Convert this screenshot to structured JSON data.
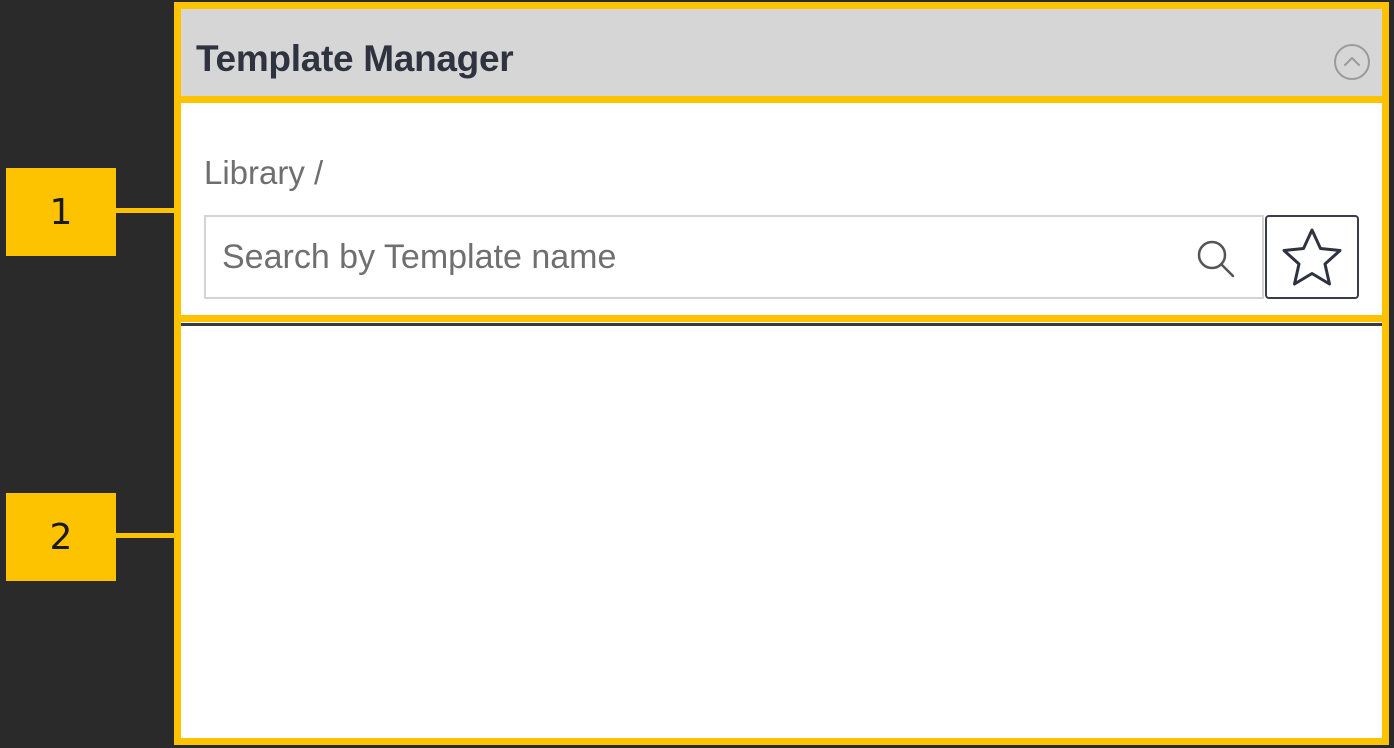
{
  "callouts": {
    "one": "1",
    "two": "2"
  },
  "panel": {
    "title": "Template Manager",
    "collapse_icon": "chevron-up-circle-icon"
  },
  "breadcrumb": {
    "text": "Library /"
  },
  "search": {
    "value": "",
    "placeholder": "Search by Template name",
    "icon": "search-icon"
  },
  "favorites": {
    "icon": "star-icon"
  },
  "colors": {
    "accent": "#fdc300",
    "background": "#2a2a2a",
    "header_bg": "#d6d6d6",
    "title_text": "#2f3340"
  }
}
